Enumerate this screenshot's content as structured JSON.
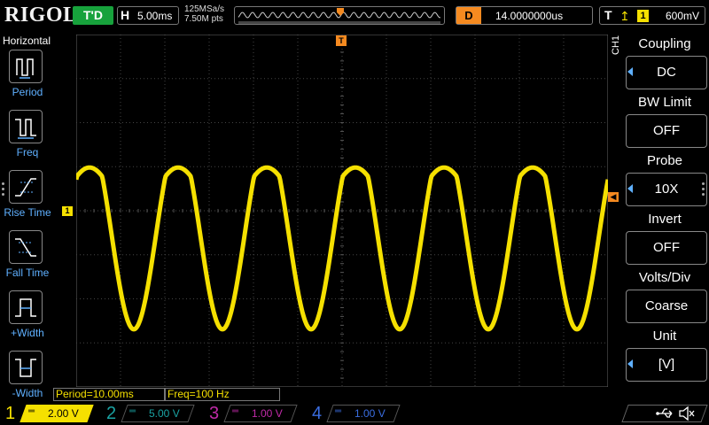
{
  "brand": "RIGOL",
  "topbar": {
    "run_state": "T'D",
    "horizontal_label": "H",
    "timebase": "5.00ms",
    "sample_rate": "125MSa/s",
    "memory_depth": "7.50M pts",
    "delay_label": "D",
    "delay_value": "14.0000000us",
    "trigger_label": "T",
    "trigger_source": "1",
    "trigger_level": "600mV"
  },
  "left_menu": {
    "title": "Horizontal",
    "items": [
      {
        "label": "Period",
        "icon": "period-icon"
      },
      {
        "label": "Freq",
        "icon": "frequency-icon"
      },
      {
        "label": "Rise Time",
        "icon": "rise-time-icon"
      },
      {
        "label": "Fall Time",
        "icon": "fall-time-icon"
      },
      {
        "label": "+Width",
        "icon": "positive-width-icon"
      },
      {
        "label": "-Width",
        "icon": "negative-width-icon"
      }
    ]
  },
  "measurements": {
    "period": "Period=10.00ms",
    "freq": "Freq=100 Hz"
  },
  "right_menu": {
    "channel": "CH1",
    "items": [
      {
        "label": "Coupling",
        "value": "DC",
        "has_arrow": true
      },
      {
        "label": "BW Limit",
        "value": "OFF",
        "has_arrow": false
      },
      {
        "label": "Probe",
        "value": "10X",
        "has_arrow": true
      },
      {
        "label": "Invert",
        "value": "OFF",
        "has_arrow": false
      },
      {
        "label": "Volts/Div",
        "value": "Coarse",
        "has_arrow": false
      },
      {
        "label": "Unit",
        "value": "[V]",
        "has_arrow": true
      }
    ]
  },
  "channels": [
    {
      "num": "1",
      "coupling": "═",
      "scale": "2.00 V",
      "active": true,
      "color": "#f5e000"
    },
    {
      "num": "2",
      "coupling": "═",
      "scale": "5.00 V",
      "active": false,
      "color": "#1aa3a3"
    },
    {
      "num": "3",
      "coupling": "═",
      "scale": "1.00 V",
      "active": false,
      "color": "#c02aa8"
    },
    {
      "num": "4",
      "coupling": "═",
      "scale": "1.00 V",
      "active": false,
      "color": "#3a6de0"
    }
  ],
  "markers": {
    "ch1": "1",
    "trigger_position": "T"
  },
  "colors": {
    "ch1": "#f5e000",
    "trigger": "#f58a20",
    "menu_text": "#5fb0ff",
    "run_state_bg": "#17a23c"
  },
  "waveform": {
    "signal": "sine",
    "frequency_hz": 100,
    "timebase_s_per_div": 0.005,
    "volts_per_div": 2.0,
    "amplitude_divs": 2.3,
    "offset_divs": -0.55,
    "flat_top": true
  }
}
